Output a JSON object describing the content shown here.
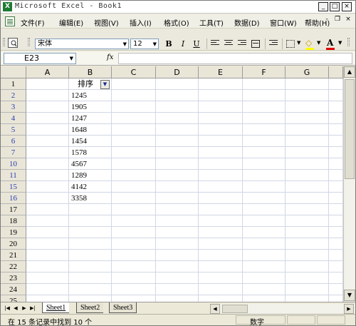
{
  "window": {
    "title": "Microsoft Excel - Book1",
    "app_icon": "X",
    "minimize": "_",
    "restore": "□",
    "close": "×"
  },
  "menu": {
    "items": [
      "文件(F)",
      "编辑(E)",
      "视图(V)",
      "插入(I)",
      "格式(O)",
      "工具(T)",
      "数据(D)",
      "窗口(W)",
      "帮助(H)"
    ],
    "mdi_minimize": "-",
    "mdi_restore": "❐",
    "mdi_close": "×"
  },
  "toolbar": {
    "font_name": "宋体",
    "font_size": "12",
    "bold": "B",
    "italic": "I",
    "underline": "U",
    "font_color_label": "A"
  },
  "formula_bar": {
    "name_box": "E23",
    "fx": "fx",
    "formula": ""
  },
  "grid": {
    "columns": [
      "A",
      "B",
      "C",
      "D",
      "E",
      "F",
      "G"
    ],
    "rows": [
      {
        "num": "1",
        "b": "排序",
        "filtered": false
      },
      {
        "num": "2",
        "b": "1245",
        "filtered": true
      },
      {
        "num": "3",
        "b": "1905",
        "filtered": true
      },
      {
        "num": "4",
        "b": "1247",
        "filtered": true
      },
      {
        "num": "5",
        "b": "1648",
        "filtered": true
      },
      {
        "num": "6",
        "b": "1454",
        "filtered": true
      },
      {
        "num": "7",
        "b": "1578",
        "filtered": true
      },
      {
        "num": "10",
        "b": "4567",
        "filtered": true
      },
      {
        "num": "11",
        "b": "1289",
        "filtered": true
      },
      {
        "num": "15",
        "b": "4142",
        "filtered": true
      },
      {
        "num": "16",
        "b": "3358",
        "filtered": true
      },
      {
        "num": "17",
        "b": "",
        "filtered": false
      },
      {
        "num": "18",
        "b": "",
        "filtered": false
      },
      {
        "num": "19",
        "b": "",
        "filtered": false
      },
      {
        "num": "20",
        "b": "",
        "filtered": false
      },
      {
        "num": "21",
        "b": "",
        "filtered": false
      },
      {
        "num": "22",
        "b": "",
        "filtered": false
      },
      {
        "num": "23",
        "b": "",
        "filtered": false
      },
      {
        "num": "24",
        "b": "",
        "filtered": false
      },
      {
        "num": "25",
        "b": "",
        "filtered": false
      }
    ],
    "filter_icon": "▼",
    "filtered_row_color": "#2b3db4"
  },
  "sheets": {
    "tabs": [
      "Sheet1",
      "Sheet2",
      "Sheet3"
    ],
    "active": "Sheet1",
    "nav": [
      "|◀",
      "◀",
      "▶",
      "▶|"
    ]
  },
  "status": {
    "message": "在 15 条记录中找到 10 个",
    "mode": "数字"
  },
  "icons": {
    "app": "excel-icon",
    "workbook": "document-icon",
    "preview": "print-preview-icon",
    "filter": "autofilter-dropdown-icon"
  }
}
